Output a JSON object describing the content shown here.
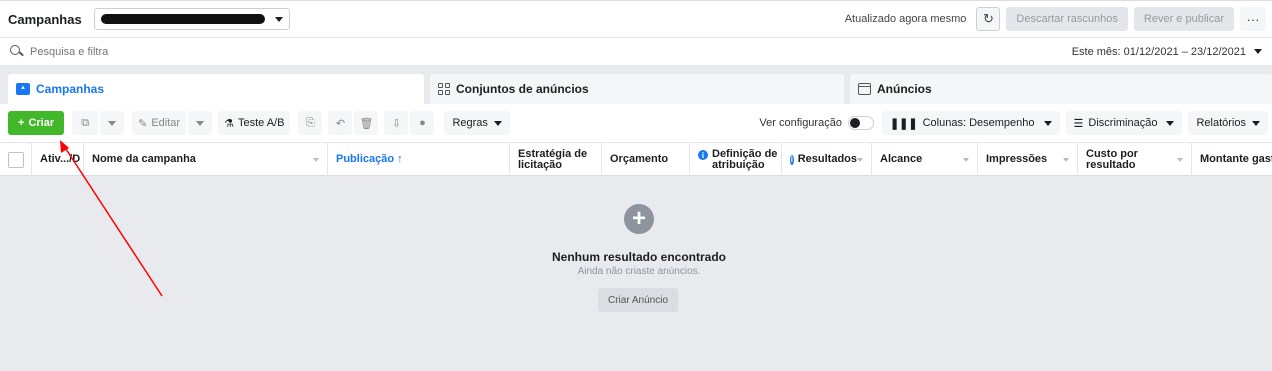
{
  "header": {
    "title": "Campanhas",
    "updated_text": "Atualizado agora mesmo",
    "discard_label": "Descartar rascunhos",
    "review_label": "Rever e publicar",
    "more_label": "···"
  },
  "search": {
    "placeholder": "Pesquisa e filtra",
    "date_range": "Este mês: 01/12/2021 – 23/12/2021"
  },
  "tabs": [
    {
      "label": "Campanhas"
    },
    {
      "label": "Conjuntos de anúncios"
    },
    {
      "label": "Anúncios"
    }
  ],
  "toolbar": {
    "create_label": "Criar",
    "edit_label": "Editar",
    "ab_label": "Teste A/B",
    "rules_label": "Regras",
    "view_setup_label": "Ver configuração",
    "columns_label": "Colunas: Desempenho",
    "breakdown_label": "Discriminação",
    "reports_label": "Relatórios"
  },
  "table": {
    "columns": [
      "Ativ.../D",
      "Nome da campanha",
      "Publicação ↑",
      "Estratégia de licitação",
      "Orçamento",
      "Definição de atribuição",
      "Resultados",
      "Alcance",
      "Impressões",
      "Custo por resultado",
      "Montante gasto"
    ]
  },
  "empty_state": {
    "icon": "+",
    "title": "Nenhum resultado encontrado",
    "subtitle": "Ainda não criaste anúncios.",
    "button_label": "Criar Anúncio"
  },
  "colors": {
    "accent": "#1877f2",
    "create": "#42b72a",
    "annotation": "#ff0000"
  }
}
